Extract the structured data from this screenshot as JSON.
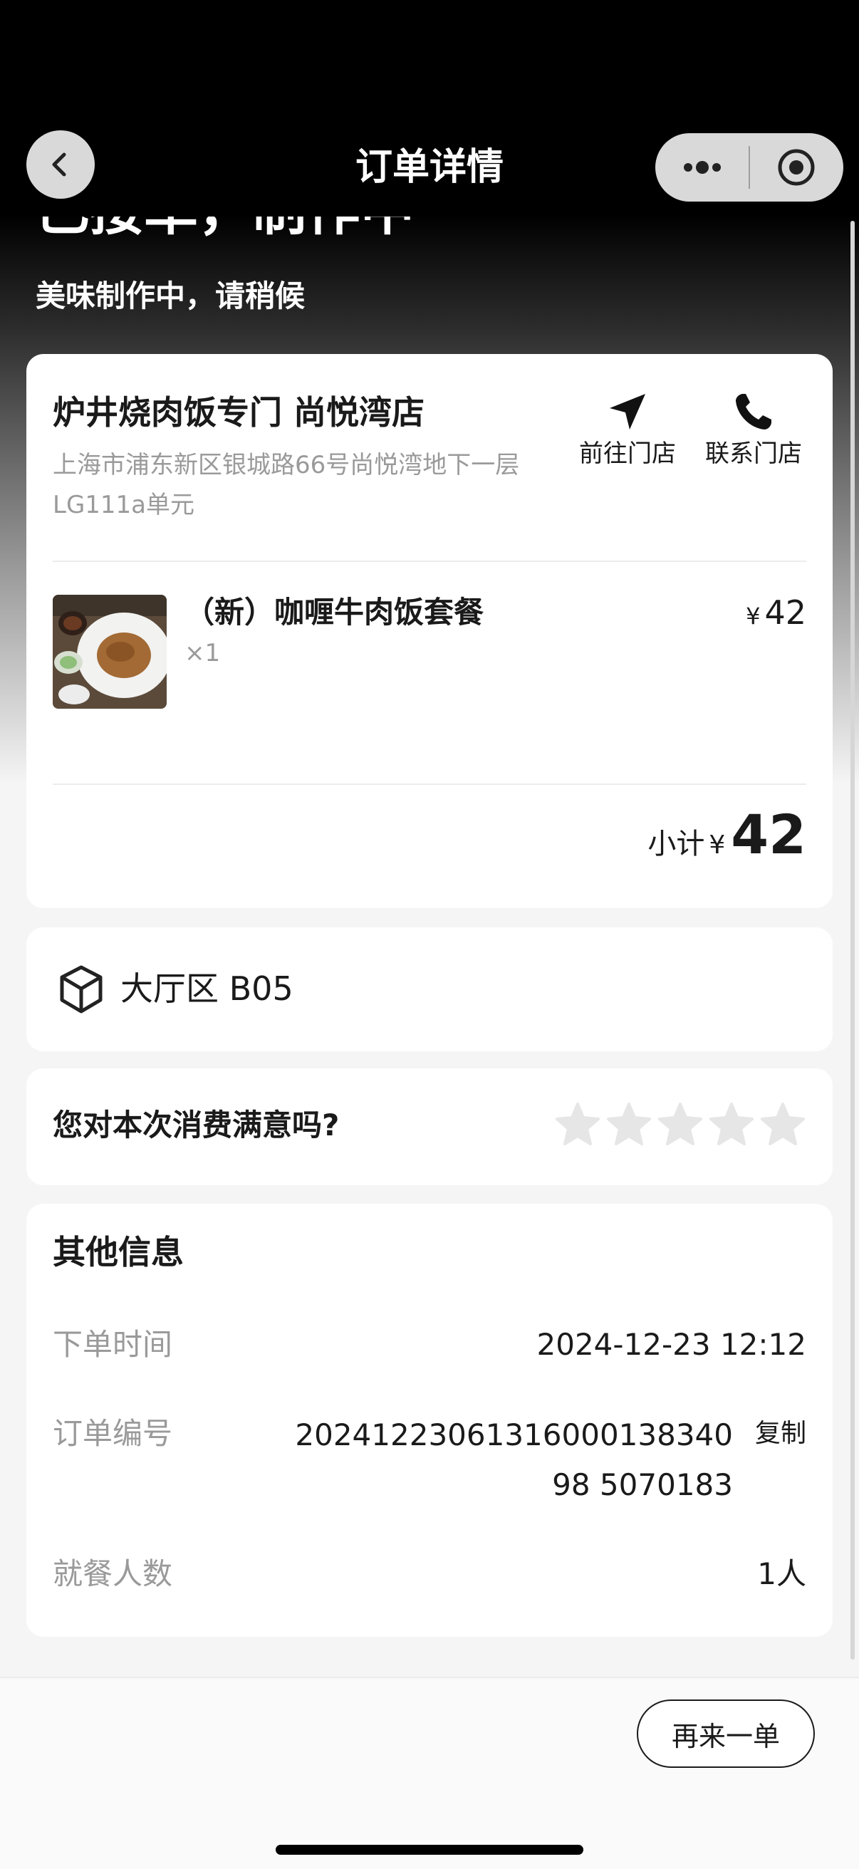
{
  "navbar": {
    "title": "订单详情",
    "back_icon": "chevron-left-icon",
    "more_icon": "more-dots-icon",
    "close_icon": "target-close-icon"
  },
  "status": {
    "title": "已接单，制作中",
    "subtitle": "美味制作中，请稍候"
  },
  "shop": {
    "name": "炉井烧肉饭专门 尚悦湾店",
    "address": "上海市浦东新区银城路66号尚悦湾地下一层LG111a单元",
    "navigate_label": "前往门店",
    "navigate_icon": "navigation-arrow-icon",
    "contact_label": "联系门店",
    "contact_icon": "phone-icon"
  },
  "order_items": [
    {
      "name": "（新）咖喱牛肉饭套餐",
      "qty": "×1",
      "currency": "¥",
      "price": "42"
    }
  ],
  "subtotal": {
    "label": "小计",
    "currency": "¥",
    "amount": "42"
  },
  "table": {
    "icon": "box-icon",
    "text": "大厅区 B05"
  },
  "rating": {
    "question": "您对本次消费满意吗?",
    "stars_total": 5,
    "stars_filled": 0,
    "star_color": "#e6e6e6"
  },
  "info": {
    "title": "其他信息",
    "order_time_label": "下单时间",
    "order_time": "2024-12-23 12:12",
    "order_no_label": "订单编号",
    "order_no": "202412230613160001383409850701 83",
    "order_no_display": "2024122306131600013834098 5070183",
    "copy_label": "复制",
    "diners_label": "就餐人数",
    "diners": "1人"
  },
  "actions": {
    "reorder_label": "再来一单"
  }
}
